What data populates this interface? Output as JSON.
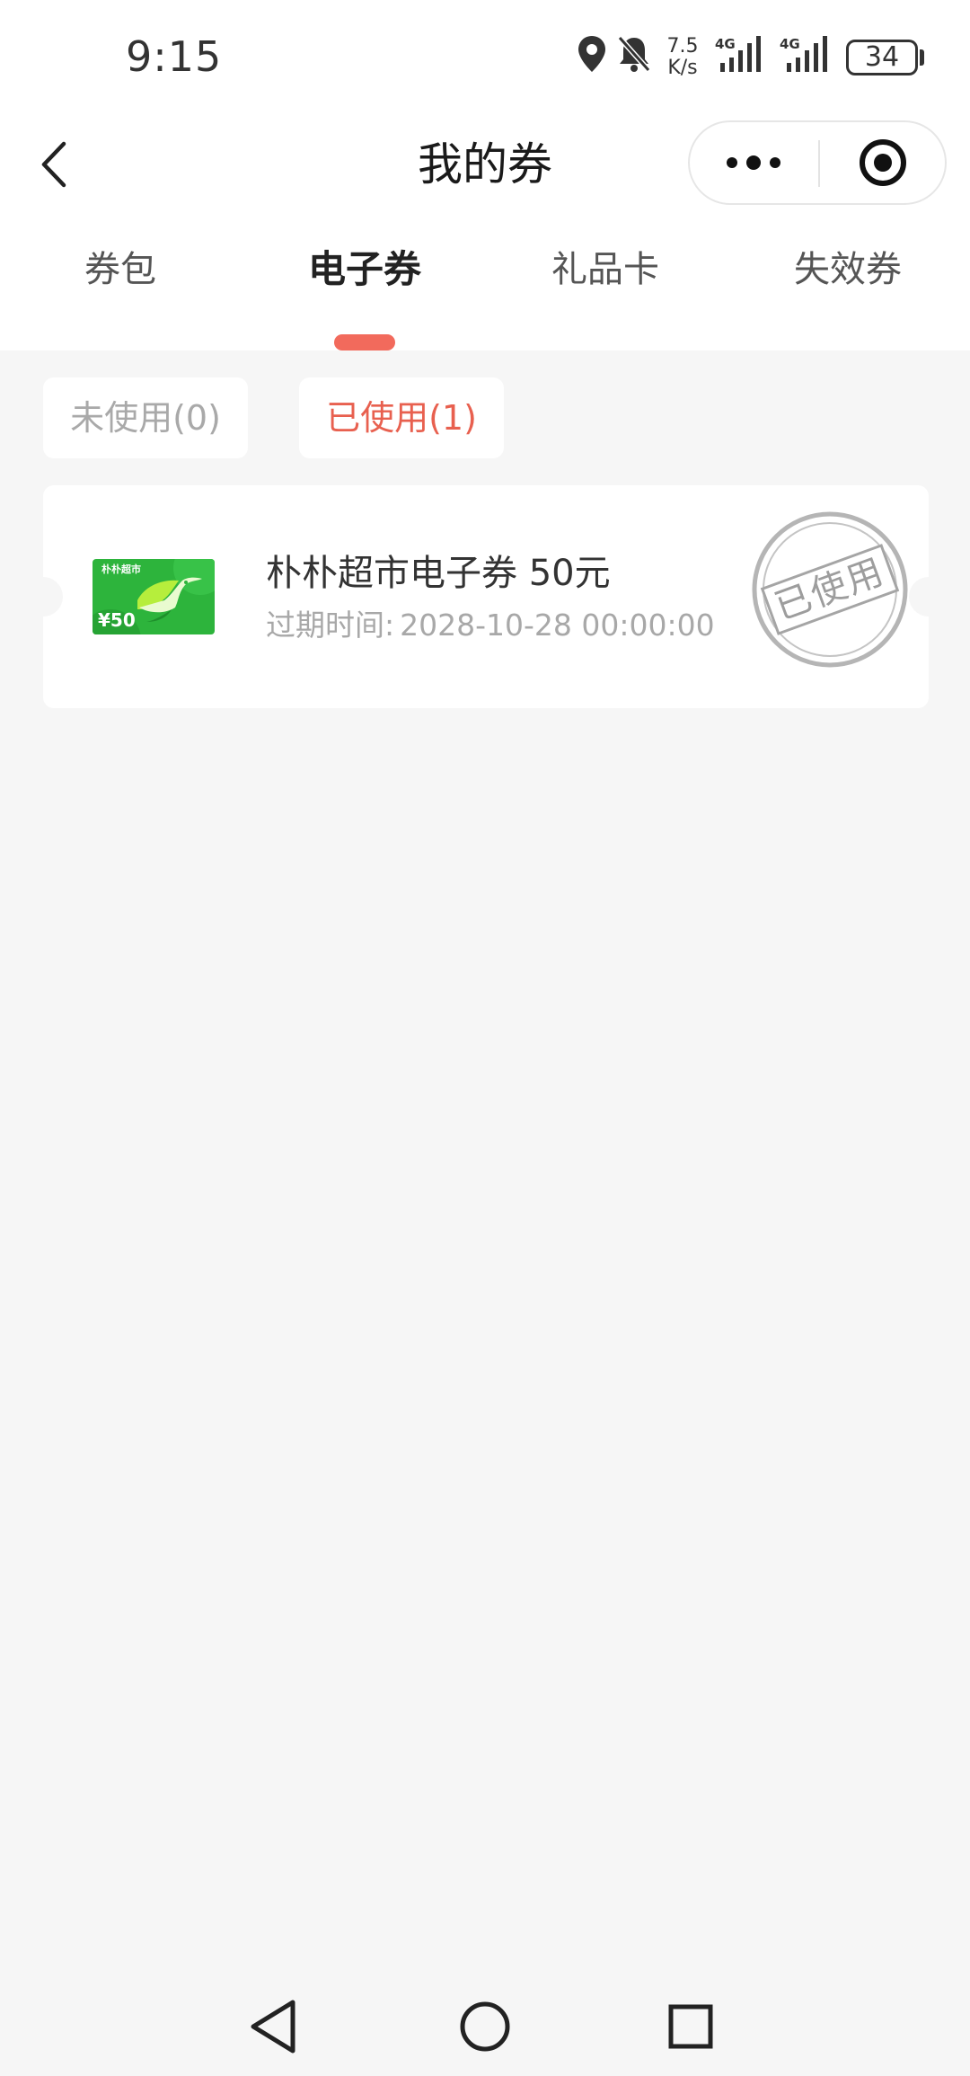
{
  "status_bar": {
    "time": "9:15",
    "net_speed_value": "7.5",
    "net_speed_unit": "K/s",
    "signal_1_label": "4G",
    "signal_2_label": "4G",
    "battery": "34",
    "icons": [
      "location-icon",
      "bell-muted-icon",
      "signal-icon",
      "battery-icon"
    ]
  },
  "nav": {
    "title": "我的券",
    "back_icon": "chevron-left-icon",
    "more_icon": "more-dots-icon",
    "close_icon": "target-close-icon"
  },
  "tabs": [
    {
      "label": "券包",
      "active": false
    },
    {
      "label": "电子券",
      "active": true
    },
    {
      "label": "礼品卡",
      "active": false
    },
    {
      "label": "失效券",
      "active": false
    }
  ],
  "filters": {
    "unused": "未使用(0)",
    "used": "已使用(1)"
  },
  "coupon": {
    "image_brand": "朴朴超市",
    "image_amount": "¥50",
    "title": "朴朴超市电子券 50元",
    "expiry_label": "过期时间:",
    "expiry_value": "2028-10-28 00:00:00",
    "stamp": "已使用"
  },
  "colors": {
    "accent": "#f26a5c",
    "used_chip_text": "#e8604f",
    "page_bg": "#f6f6f6",
    "card_green": "#2db43c"
  }
}
